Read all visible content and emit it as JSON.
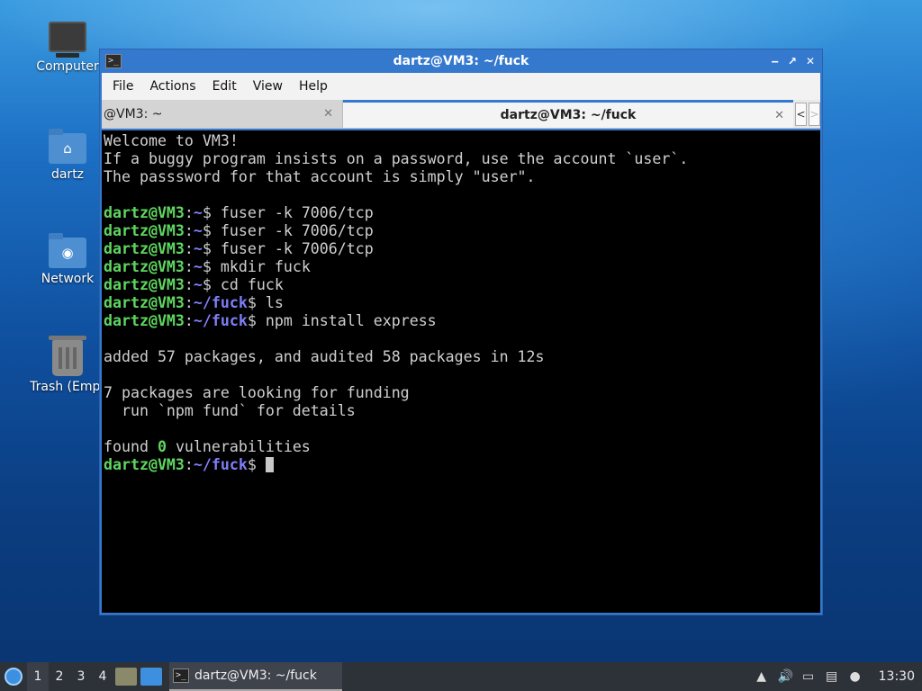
{
  "desktop": {
    "icons": [
      {
        "label": "Computer",
        "icon": "computer-icon"
      },
      {
        "label": "dartz",
        "icon": "home-folder-icon"
      },
      {
        "label": "Network",
        "icon": "network-folder-icon"
      },
      {
        "label": "Trash (Empt",
        "icon": "trash-icon"
      }
    ]
  },
  "window": {
    "title": "dartz@VM3: ~/fuck",
    "controls": {
      "minimize": "‒",
      "maximize": "↗",
      "close": "✕"
    },
    "menu": [
      "File",
      "Actions",
      "Edit",
      "View",
      "Help"
    ],
    "tabs": [
      {
        "label": "@VM3: ~",
        "active": false
      },
      {
        "label": "dartz@VM3: ~/fuck",
        "active": true
      }
    ],
    "tab_close": "✕",
    "tab_nav": {
      "prev": "<",
      "next": ">"
    }
  },
  "terminal": {
    "lines": [
      {
        "type": "text",
        "text": "Welcome to VM3!"
      },
      {
        "type": "text",
        "text": "If a buggy program insists on a password, use the account `user`."
      },
      {
        "type": "text",
        "text": "The passsword for that account is simply \"user\"."
      },
      {
        "type": "blank"
      },
      {
        "type": "prompt",
        "user": "dartz@VM3",
        "path": "~",
        "cmd": "fuser -k 7006/tcp"
      },
      {
        "type": "prompt",
        "user": "dartz@VM3",
        "path": "~",
        "cmd": "fuser -k 7006/tcp"
      },
      {
        "type": "prompt",
        "user": "dartz@VM3",
        "path": "~",
        "cmd": "fuser -k 7006/tcp"
      },
      {
        "type": "prompt",
        "user": "dartz@VM3",
        "path": "~",
        "cmd": "mkdir fuck"
      },
      {
        "type": "prompt",
        "user": "dartz@VM3",
        "path": "~",
        "cmd": "cd fuck"
      },
      {
        "type": "prompt",
        "user": "dartz@VM3",
        "path": "~/fuck",
        "cmd": "ls"
      },
      {
        "type": "prompt",
        "user": "dartz@VM3",
        "path": "~/fuck",
        "cmd": "npm install express"
      },
      {
        "type": "blank"
      },
      {
        "type": "text",
        "text": "added 57 packages, and audited 58 packages in 12s"
      },
      {
        "type": "blank"
      },
      {
        "type": "text",
        "text": "7 packages are looking for funding"
      },
      {
        "type": "text",
        "text": "  run `npm fund` for details"
      },
      {
        "type": "blank"
      },
      {
        "type": "vuln",
        "before": "found ",
        "count": "0",
        "after": " vulnerabilities"
      },
      {
        "type": "prompt-cursor",
        "user": "dartz@VM3",
        "path": "~/fuck",
        "cmd": ""
      }
    ]
  },
  "taskbar": {
    "workspaces": [
      "1",
      "2",
      "3",
      "4"
    ],
    "active_workspace": "1",
    "task_label": "dartz@VM3: ~/fuck",
    "clock": "13:30"
  }
}
